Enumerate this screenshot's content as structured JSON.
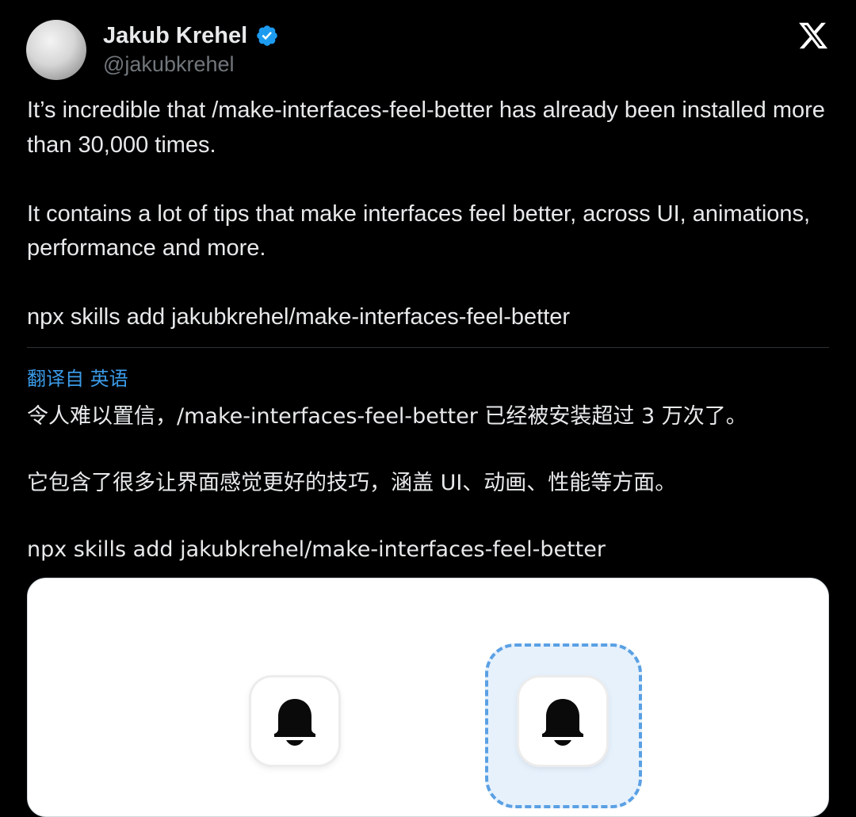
{
  "author": {
    "display_name": "Jakub Krehel",
    "handle": "@jakubkrehel",
    "verified": true,
    "avatar_icon": "avatar-sphere-icon"
  },
  "brand": {
    "logo_icon": "x-logo-icon",
    "accent_color": "#1d9bf0",
    "link_color": "#3b9be8"
  },
  "tweet": {
    "paragraphs": [
      "It’s incredible that /make-interfaces-feel-better has already been installed more than 30,000 times.",
      "It contains a lot of tips that make interfaces feel better, across UI, animations, performance and more.",
      "npx skills add jakubkrehel/make-interfaces-feel-better"
    ]
  },
  "translation": {
    "label": "翻译自 英语",
    "paragraphs": [
      "令人难以置信，/make-interfaces-feel-better 已经被安装超过 3 万次了。",
      "它包含了很多让界面感觉更好的技巧，涵盖 UI、动画、性能等方面。",
      "npx skills add jakubkrehel/make-interfaces-feel-better"
    ]
  },
  "media": {
    "icons": [
      "bell-app-icon",
      "bell-app-icon-selected"
    ]
  }
}
